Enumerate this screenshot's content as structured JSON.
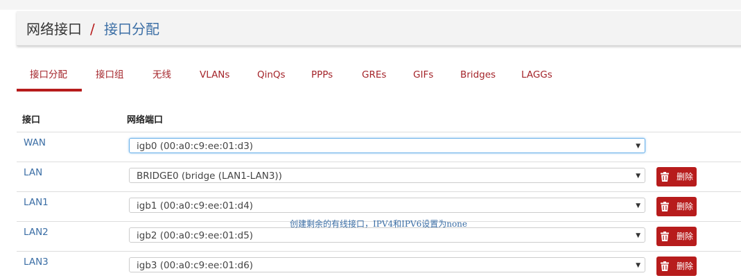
{
  "breadcrumb": {
    "parent": "网络接口",
    "separator": "/",
    "current": "接口分配"
  },
  "tabs": [
    {
      "label": "接口分配",
      "active": true
    },
    {
      "label": "接口组"
    },
    {
      "label": "无线"
    },
    {
      "label": "VLANs"
    },
    {
      "label": "QinQs"
    },
    {
      "label": "PPPs"
    },
    {
      "label": "GREs"
    },
    {
      "label": "GIFs"
    },
    {
      "label": "Bridges"
    },
    {
      "label": "LAGGs"
    }
  ],
  "table": {
    "headers": {
      "interface": "接口",
      "network_port": "网络端口"
    },
    "rows": [
      {
        "interface": "WAN",
        "port": "igb0 (00:a0:c9:ee:01:d3)"
      },
      {
        "interface": "LAN",
        "port": "BRIDGE0 (bridge (LAN1-LAN3))",
        "delete_label": "删除"
      },
      {
        "interface": "LAN1",
        "port": "igb1 (00:a0:c9:ee:01:d4)",
        "delete_label": "删除"
      },
      {
        "interface": "LAN2",
        "port": "igb2 (00:a0:c9:ee:01:d5)",
        "delete_label": "删除"
      },
      {
        "interface": "LAN3",
        "port": "igb3 (00:a0:c9:ee:01:d6)",
        "delete_label": "删除"
      }
    ]
  },
  "annotation": "创建剩余的有线接口，IPV4和IPV6设置为none",
  "icons": {
    "delete": "trash-icon",
    "dropdown": "caret-down-icon"
  },
  "colors": {
    "accent": "#b71c1c",
    "link": "#3b6ea5"
  }
}
